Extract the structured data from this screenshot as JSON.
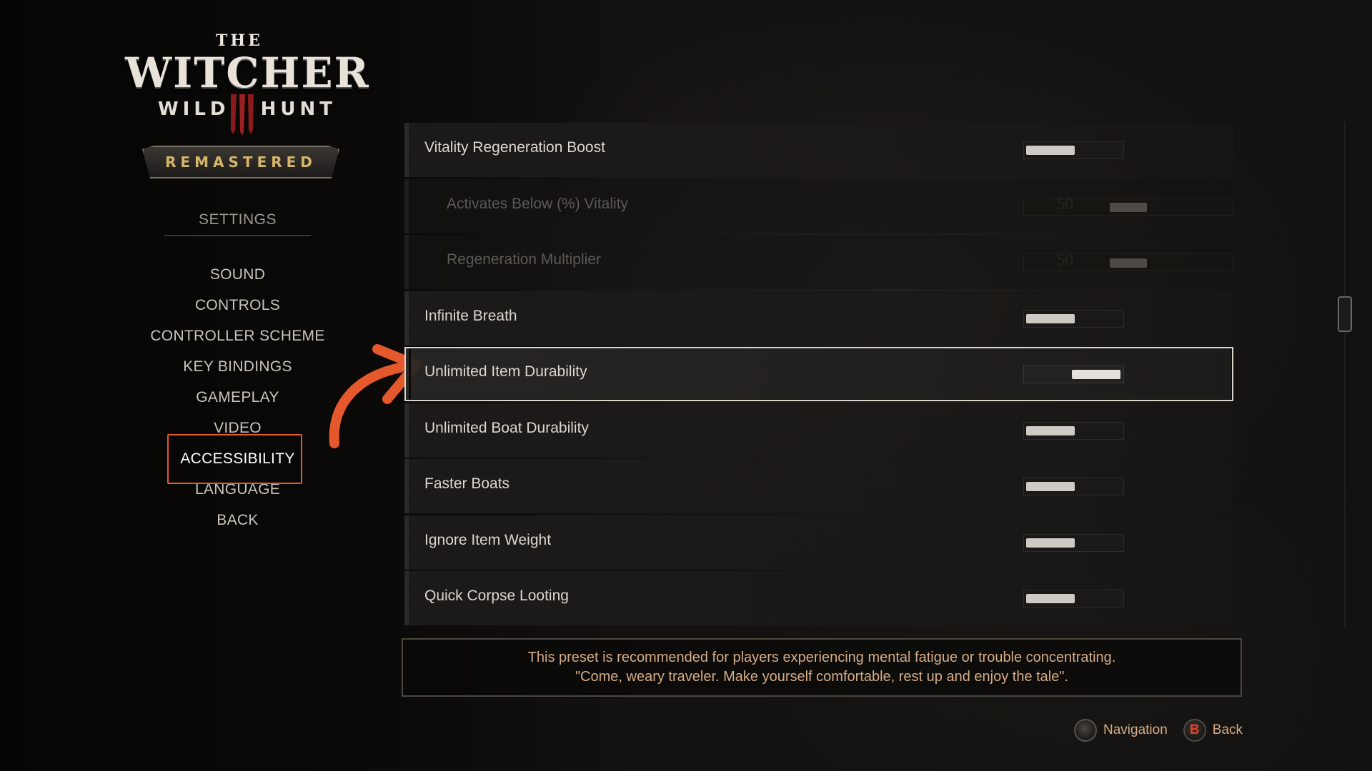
{
  "logo": {
    "the": "THE",
    "witcher": "WITCHER",
    "wild": "WILD",
    "hunt": "HUNT",
    "remastered": "REMASTERED"
  },
  "sidebar": {
    "title": "SETTINGS",
    "items": [
      {
        "label": "SOUND"
      },
      {
        "label": "CONTROLS"
      },
      {
        "label": "CONTROLLER SCHEME"
      },
      {
        "label": "KEY BINDINGS"
      },
      {
        "label": "GAMEPLAY"
      },
      {
        "label": "VIDEO"
      },
      {
        "label": "ACCESSIBILITY",
        "active": true
      },
      {
        "label": "LANGUAGE"
      },
      {
        "label": "BACK"
      }
    ]
  },
  "settings": [
    {
      "label": "Vitality Regeneration Boost",
      "value": "Off",
      "control": "toggle"
    },
    {
      "label": "Activates Below (%) Vitality",
      "value": "50",
      "control": "slider",
      "level_percent": 50,
      "disabled": true
    },
    {
      "label": "Regeneration Multiplier",
      "value": "50",
      "control": "slider",
      "level_percent": 50,
      "disabled": true
    },
    {
      "label": "Infinite Breath",
      "value": "Off",
      "control": "toggle"
    },
    {
      "label": "Unlimited Item Durability",
      "value": "On",
      "control": "toggle",
      "selected": true
    },
    {
      "label": "Unlimited Boat Durability",
      "value": "Off",
      "control": "toggle"
    },
    {
      "label": "Faster Boats",
      "value": "Off",
      "control": "toggle"
    },
    {
      "label": "Ignore Item Weight",
      "value": "Off",
      "control": "toggle"
    },
    {
      "label": "Quick Corpse Looting",
      "value": "Off",
      "control": "toggle"
    }
  ],
  "description": {
    "line1": "This preset is recommended for players experiencing mental fatigue or trouble concentrating.",
    "line2": "\"Come, weary traveler. Make yourself comfortable, rest up and enjoy the tale\"."
  },
  "footer": {
    "navigation_label": "Navigation",
    "back_button_glyph": "B",
    "back_label": "Back"
  },
  "colors": {
    "highlight_annotation": "#e4582c",
    "description_text": "#d6ac86",
    "remastered_gold": "#d7b56a",
    "b_button_red": "#e0402c"
  },
  "icons": {
    "navigation": "left-stick-icon",
    "back": "b-button-icon",
    "annotation": "curved-arrow-icon"
  }
}
